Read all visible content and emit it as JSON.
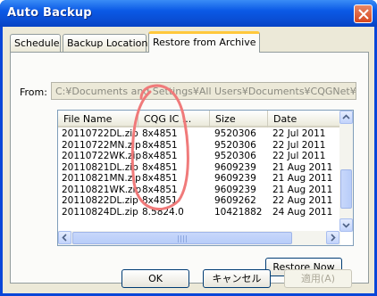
{
  "window": {
    "title": "Auto Backup"
  },
  "tabs": [
    {
      "label": "Schedule"
    },
    {
      "label": "Backup Location"
    },
    {
      "label": "Restore from Archive"
    }
  ],
  "from": {
    "label": "From:",
    "value": "C:¥Documents and Settings¥All Users¥Documents¥CQGNet¥"
  },
  "list": {
    "columns": [
      "File Name",
      "CQG IC ...",
      "Size",
      "Date"
    ],
    "rows": [
      [
        "20110722DL.zip",
        "8x4851",
        "9520306",
        "22 Jul 2011"
      ],
      [
        "20110722MN.zip",
        "8x4851",
        "9520306",
        "22 Jul 2011"
      ],
      [
        "20110722WK.zip",
        "8x4851",
        "9520306",
        "22 Jul 2011"
      ],
      [
        "20110821DL.zip",
        "8x4851",
        "9609239",
        "21 Aug 2011"
      ],
      [
        "20110821MN.zip",
        "8x4851",
        "9609239",
        "21 Aug 2011"
      ],
      [
        "20110821WK.zip",
        "8x4851",
        "9609239",
        "21 Aug 2011"
      ],
      [
        "20110822DL.zip",
        "8x4851",
        "9609262",
        "22 Aug 2011"
      ],
      [
        "20110824DL.zip",
        "8.5824.0",
        "10421882",
        "24 Aug 2011"
      ]
    ]
  },
  "buttons": {
    "restore_now": "Restore Now",
    "ok": "OK",
    "cancel": "キャンセル",
    "apply": "適用(A)"
  },
  "colors": {
    "annotation": "#f07a7a",
    "selection_tab": "#ffc83c",
    "titlebar": "#0b5ae6"
  }
}
